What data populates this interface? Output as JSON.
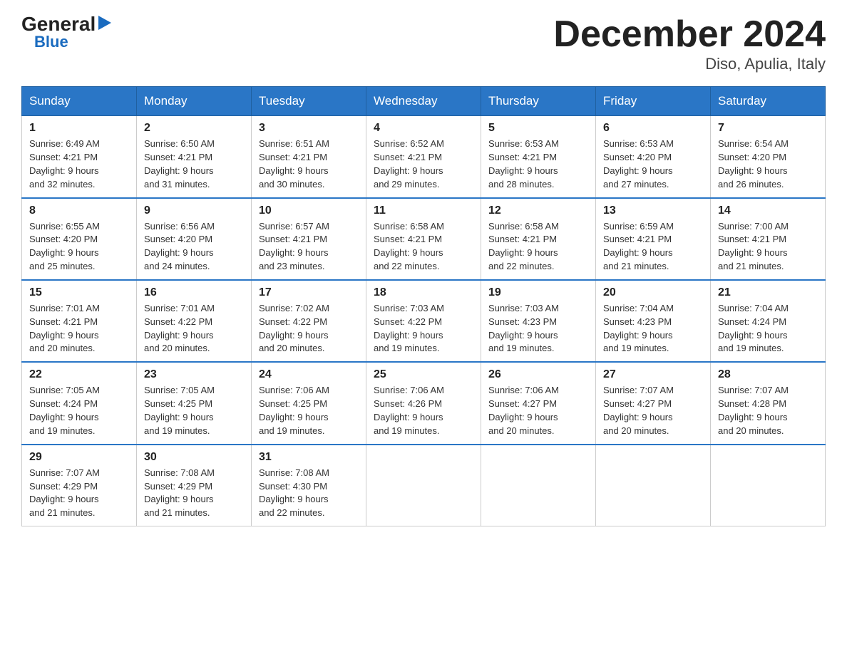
{
  "logo": {
    "general": "General",
    "blue": "Blue",
    "triangle": "▶"
  },
  "title": "December 2024",
  "subtitle": "Diso, Apulia, Italy",
  "days_of_week": [
    "Sunday",
    "Monday",
    "Tuesday",
    "Wednesday",
    "Thursday",
    "Friday",
    "Saturday"
  ],
  "weeks": [
    [
      {
        "day": "1",
        "sunrise": "6:49 AM",
        "sunset": "4:21 PM",
        "daylight": "9 hours and 32 minutes."
      },
      {
        "day": "2",
        "sunrise": "6:50 AM",
        "sunset": "4:21 PM",
        "daylight": "9 hours and 31 minutes."
      },
      {
        "day": "3",
        "sunrise": "6:51 AM",
        "sunset": "4:21 PM",
        "daylight": "9 hours and 30 minutes."
      },
      {
        "day": "4",
        "sunrise": "6:52 AM",
        "sunset": "4:21 PM",
        "daylight": "9 hours and 29 minutes."
      },
      {
        "day": "5",
        "sunrise": "6:53 AM",
        "sunset": "4:21 PM",
        "daylight": "9 hours and 28 minutes."
      },
      {
        "day": "6",
        "sunrise": "6:53 AM",
        "sunset": "4:20 PM",
        "daylight": "9 hours and 27 minutes."
      },
      {
        "day": "7",
        "sunrise": "6:54 AM",
        "sunset": "4:20 PM",
        "daylight": "9 hours and 26 minutes."
      }
    ],
    [
      {
        "day": "8",
        "sunrise": "6:55 AM",
        "sunset": "4:20 PM",
        "daylight": "9 hours and 25 minutes."
      },
      {
        "day": "9",
        "sunrise": "6:56 AM",
        "sunset": "4:20 PM",
        "daylight": "9 hours and 24 minutes."
      },
      {
        "day": "10",
        "sunrise": "6:57 AM",
        "sunset": "4:21 PM",
        "daylight": "9 hours and 23 minutes."
      },
      {
        "day": "11",
        "sunrise": "6:58 AM",
        "sunset": "4:21 PM",
        "daylight": "9 hours and 22 minutes."
      },
      {
        "day": "12",
        "sunrise": "6:58 AM",
        "sunset": "4:21 PM",
        "daylight": "9 hours and 22 minutes."
      },
      {
        "day": "13",
        "sunrise": "6:59 AM",
        "sunset": "4:21 PM",
        "daylight": "9 hours and 21 minutes."
      },
      {
        "day": "14",
        "sunrise": "7:00 AM",
        "sunset": "4:21 PM",
        "daylight": "9 hours and 21 minutes."
      }
    ],
    [
      {
        "day": "15",
        "sunrise": "7:01 AM",
        "sunset": "4:21 PM",
        "daylight": "9 hours and 20 minutes."
      },
      {
        "day": "16",
        "sunrise": "7:01 AM",
        "sunset": "4:22 PM",
        "daylight": "9 hours and 20 minutes."
      },
      {
        "day": "17",
        "sunrise": "7:02 AM",
        "sunset": "4:22 PM",
        "daylight": "9 hours and 20 minutes."
      },
      {
        "day": "18",
        "sunrise": "7:03 AM",
        "sunset": "4:22 PM",
        "daylight": "9 hours and 19 minutes."
      },
      {
        "day": "19",
        "sunrise": "7:03 AM",
        "sunset": "4:23 PM",
        "daylight": "9 hours and 19 minutes."
      },
      {
        "day": "20",
        "sunrise": "7:04 AM",
        "sunset": "4:23 PM",
        "daylight": "9 hours and 19 minutes."
      },
      {
        "day": "21",
        "sunrise": "7:04 AM",
        "sunset": "4:24 PM",
        "daylight": "9 hours and 19 minutes."
      }
    ],
    [
      {
        "day": "22",
        "sunrise": "7:05 AM",
        "sunset": "4:24 PM",
        "daylight": "9 hours and 19 minutes."
      },
      {
        "day": "23",
        "sunrise": "7:05 AM",
        "sunset": "4:25 PM",
        "daylight": "9 hours and 19 minutes."
      },
      {
        "day": "24",
        "sunrise": "7:06 AM",
        "sunset": "4:25 PM",
        "daylight": "9 hours and 19 minutes."
      },
      {
        "day": "25",
        "sunrise": "7:06 AM",
        "sunset": "4:26 PM",
        "daylight": "9 hours and 19 minutes."
      },
      {
        "day": "26",
        "sunrise": "7:06 AM",
        "sunset": "4:27 PM",
        "daylight": "9 hours and 20 minutes."
      },
      {
        "day": "27",
        "sunrise": "7:07 AM",
        "sunset": "4:27 PM",
        "daylight": "9 hours and 20 minutes."
      },
      {
        "day": "28",
        "sunrise": "7:07 AM",
        "sunset": "4:28 PM",
        "daylight": "9 hours and 20 minutes."
      }
    ],
    [
      {
        "day": "29",
        "sunrise": "7:07 AM",
        "sunset": "4:29 PM",
        "daylight": "9 hours and 21 minutes."
      },
      {
        "day": "30",
        "sunrise": "7:08 AM",
        "sunset": "4:29 PM",
        "daylight": "9 hours and 21 minutes."
      },
      {
        "day": "31",
        "sunrise": "7:08 AM",
        "sunset": "4:30 PM",
        "daylight": "9 hours and 22 minutes."
      },
      null,
      null,
      null,
      null
    ]
  ],
  "labels": {
    "sunrise": "Sunrise:",
    "sunset": "Sunset:",
    "daylight": "Daylight:"
  }
}
